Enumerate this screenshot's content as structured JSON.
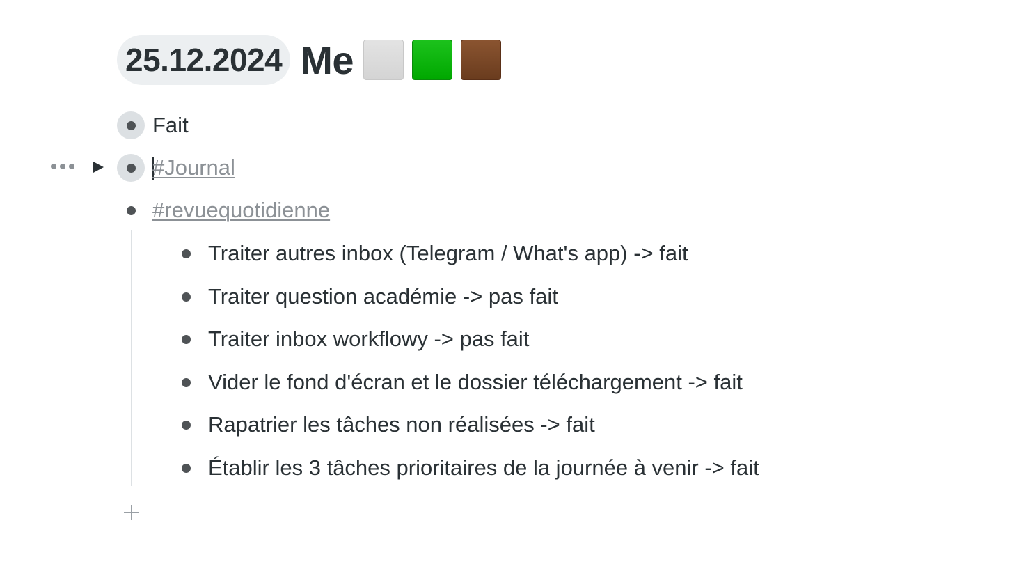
{
  "title": {
    "date": "25.12.2024",
    "text": "Me",
    "squares": [
      {
        "name": "white-square-icon",
        "color": "#d9d9d9"
      },
      {
        "name": "green-square-icon",
        "color": "#00b000"
      },
      {
        "name": "brown-square-icon",
        "color": "#7a4627"
      }
    ]
  },
  "items": [
    {
      "label": "Fait"
    },
    {
      "label": "#Journal",
      "is_tag": true
    },
    {
      "label": "#revuequotidienne",
      "is_tag": true
    }
  ],
  "children": [
    {
      "label": "Traiter autres inbox (Telegram / What's app) -> fait"
    },
    {
      "label": "Traiter question académie -> pas fait"
    },
    {
      "label": "Traiter inbox workflowy -> pas fait"
    },
    {
      "label": "Vider le fond d'écran et le dossier téléchargement -> fait"
    },
    {
      "label": "Rapatrier les tâches non réalisées -> fait"
    },
    {
      "label": "Établir les 3 tâches prioritaires de la journée à venir -> fait"
    }
  ],
  "colors": {
    "text": "#2a3135",
    "tag": "#8c9196",
    "date_pill_bg": "#eceff1",
    "bullet_ring": "#dce0e3"
  }
}
